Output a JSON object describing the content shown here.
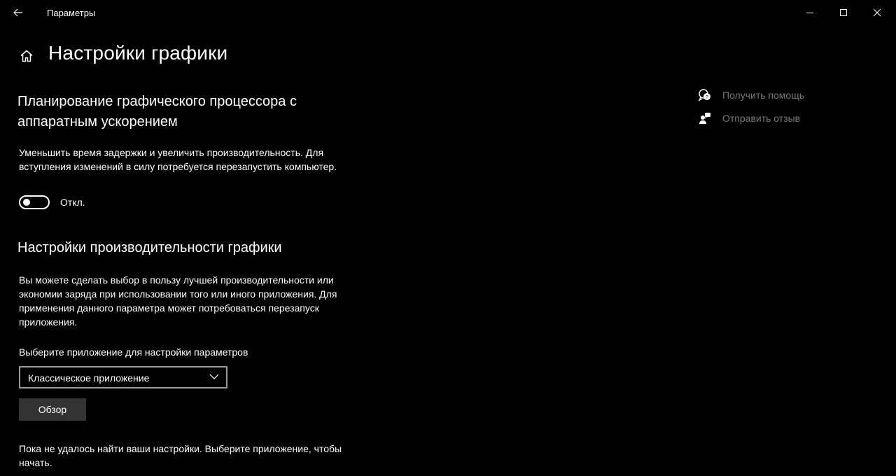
{
  "window": {
    "title": "Параметры"
  },
  "header": {
    "title": "Настройки графики"
  },
  "gpu_scheduling": {
    "heading": "Планирование графического процессора с аппаратным ускорением",
    "description": "Уменьшить время задержки и увеличить производительность. Для вступления изменений в силу потребуется перезапустить компьютер.",
    "toggle_state": "off",
    "toggle_label": "Откл."
  },
  "graphics_performance": {
    "heading": "Настройки производительности графики",
    "description": "Вы можете сделать выбор в пользу лучшей производительности или экономии заряда при использовании того или иного приложения. Для применения данного параметра может потребоваться перезапуск приложения.",
    "select_label": "Выберите приложение для настройки параметров",
    "select_value": "Классическое приложение",
    "browse_label": "Обзор",
    "status_text": "Пока не удалось найти ваши настройки. Выберите приложение, чтобы начать."
  },
  "sidebar": {
    "help_label": "Получить помощь",
    "feedback_label": "Отправить отзыв"
  },
  "icons": {
    "back": "back-arrow-icon",
    "home": "home-icon",
    "minimize": "minimize-icon",
    "maximize": "maximize-icon",
    "close": "close-icon",
    "chevron": "chevron-down-icon",
    "help": "help-chat-icon",
    "feedback": "feedback-icon"
  },
  "colors": {
    "background": "#000000",
    "text": "#ffffff",
    "muted_text": "#7a7a7a",
    "button_bg": "#333333",
    "select_border": "#9a9a9a"
  }
}
